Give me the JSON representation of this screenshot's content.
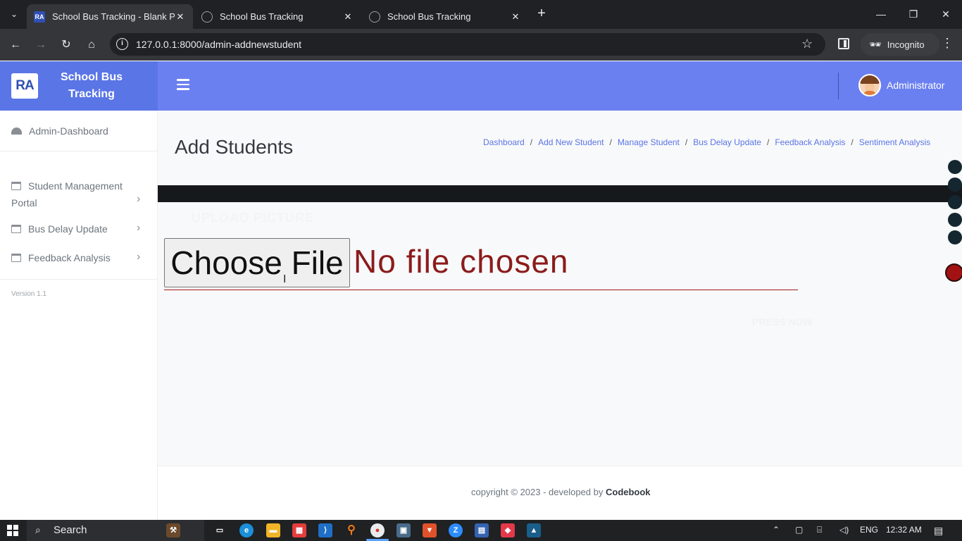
{
  "browser": {
    "tabs": [
      {
        "title": "School Bus Tracking - Blank Pa",
        "active": true,
        "favicon": "ra-logo-icon"
      },
      {
        "title": "School Bus Tracking",
        "active": false,
        "favicon": "globe-icon"
      },
      {
        "title": "School Bus Tracking",
        "active": false,
        "favicon": "globe-icon"
      }
    ],
    "url": "127.0.0.1:8000/admin-addnewstudent",
    "incognito_label": "Incognito"
  },
  "app": {
    "logo_text": "RA",
    "brand_title": "School Bus Tracking",
    "user_name": "Administrator",
    "accent": "#6b80f0"
  },
  "sidebar": {
    "items": [
      {
        "label": "Admin-Dashboard",
        "icon": "gauge-icon"
      },
      {
        "label": "Student Management Portal",
        "icon": "window-icon",
        "chevron": true
      },
      {
        "label": "Bus Delay Update",
        "icon": "window-icon",
        "chevron": true
      },
      {
        "label": "Feedback Analysis",
        "icon": "window-icon",
        "chevron": true
      }
    ],
    "version": "Version 1.1"
  },
  "main": {
    "page_title": "Add Students",
    "breadcrumbs": [
      "Dashboard",
      "Add New Student",
      "Manage Student",
      "Bus Delay Update",
      "Feedback Analysis",
      "Sentiment Analysis"
    ],
    "upload_label": "UPLOAD PICTURE",
    "choose_file_label": "Choose File",
    "no_file_text": "No file chosen",
    "faint_button_text": "PRESS NOW"
  },
  "footer": {
    "text": "copyright © 2023 - developed by ",
    "brand": "Codebook"
  },
  "taskbar": {
    "search_label": "Search",
    "language": "ENG",
    "time": "12:32 AM"
  }
}
